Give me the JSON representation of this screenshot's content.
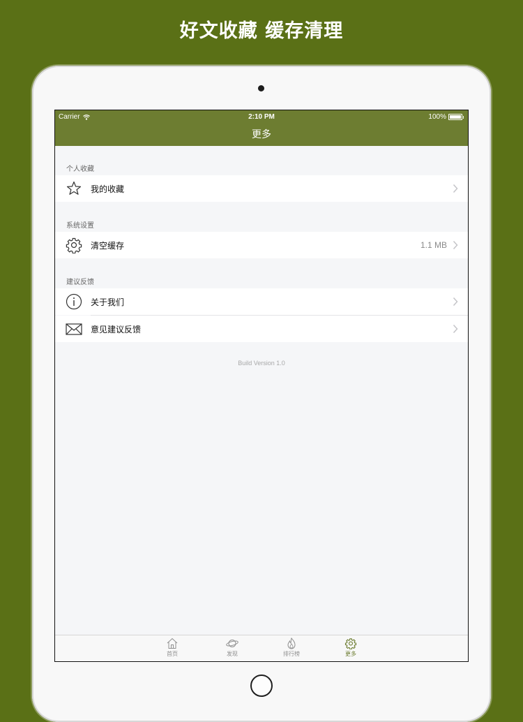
{
  "promo": {
    "title": "好文收藏 缓存清理"
  },
  "status_bar": {
    "carrier": "Carrier",
    "time": "2:10 PM",
    "battery": "100%"
  },
  "nav": {
    "title": "更多"
  },
  "sections": [
    {
      "header": "个人收藏",
      "items": [
        {
          "label": "我的收藏",
          "icon": "star-icon",
          "value": ""
        }
      ]
    },
    {
      "header": "系统设置",
      "items": [
        {
          "label": "清空缓存",
          "icon": "gear-icon",
          "value": "1.1 MB"
        }
      ]
    },
    {
      "header": "建议反馈",
      "items": [
        {
          "label": "关于我们",
          "icon": "info-icon",
          "value": ""
        },
        {
          "label": "意见建议反馈",
          "icon": "mail-icon",
          "value": ""
        }
      ]
    }
  ],
  "footer": {
    "build_version": "Build Version 1.0"
  },
  "tabbar": {
    "items": [
      {
        "label": "首页",
        "icon": "home-icon",
        "active": false
      },
      {
        "label": "发现",
        "icon": "planet-icon",
        "active": false
      },
      {
        "label": "排行榜",
        "icon": "flame-icon",
        "active": false
      },
      {
        "label": "更多",
        "icon": "gear-icon",
        "active": true
      }
    ]
  },
  "colors": {
    "background": "#5a7016",
    "nav_bar": "#6d7d31",
    "tab_active": "#6d7d31"
  }
}
